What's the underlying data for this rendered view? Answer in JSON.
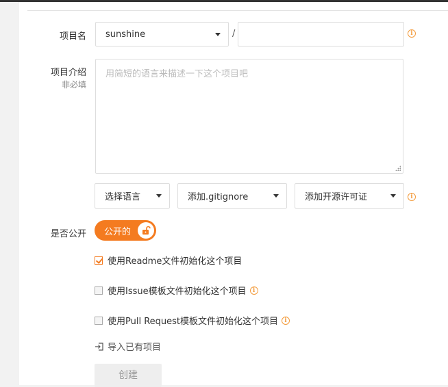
{
  "form": {
    "project_name_label": "项目名",
    "namespace_value": "sunshine",
    "separator": "/",
    "project_name_value": "",
    "description_label": "项目介绍",
    "description_sublabel": "非必填",
    "description_placeholder": "用简短的语言来描述一下这个项目吧",
    "language_select": "选择语言",
    "gitignore_select": "添加.gitignore",
    "license_select": "添加开源许可证",
    "visibility_label": "是否公开",
    "visibility_toggle": "公开的",
    "visibility_public": true,
    "init_readme": {
      "label": "使用Readme文件初始化这个项目",
      "checked": true
    },
    "init_issue_template": {
      "label": "使用Issue模板文件初始化这个项目",
      "checked": false
    },
    "init_pr_template": {
      "label": "使用Pull Request模板文件初始化这个项目",
      "checked": false
    },
    "import_link": "导入已有项目",
    "create_button": "创建"
  },
  "colors": {
    "accent": "#f47b20",
    "info": "#f39c3d",
    "border": "#dddddd"
  },
  "icons": {
    "info": "info-icon",
    "unlock": "unlock-icon",
    "import": "import-icon",
    "caret": "chevron-down-icon"
  }
}
